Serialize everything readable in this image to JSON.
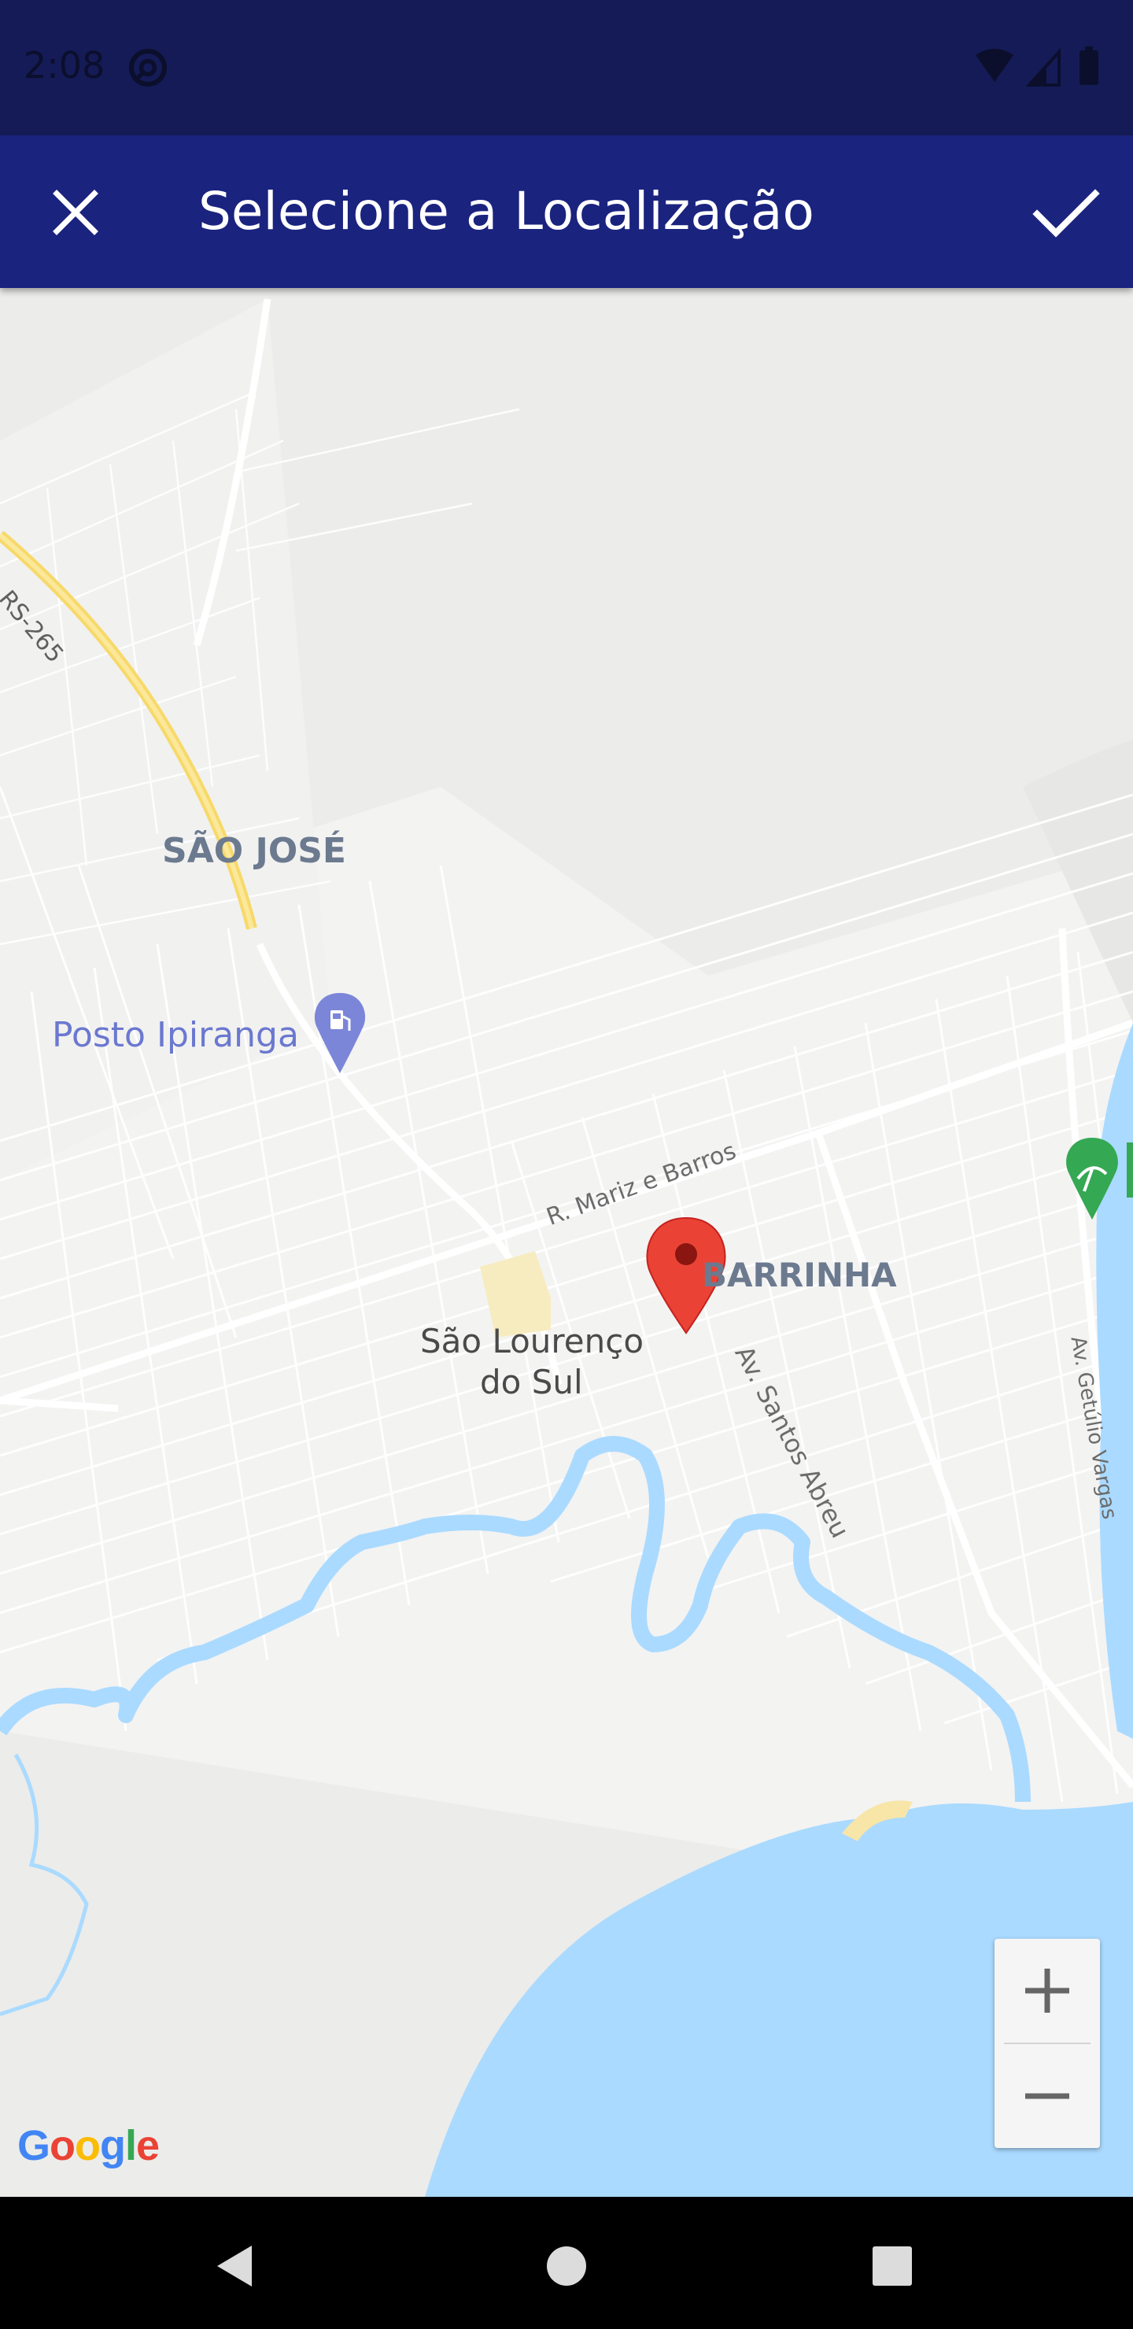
{
  "status_bar": {
    "time": "2:08",
    "icons": [
      "sync-icon",
      "wifi-icon",
      "cell-signal-icon",
      "battery-icon"
    ]
  },
  "app_bar": {
    "title": "Selecione a Localização",
    "close_icon": "close-icon",
    "confirm_icon": "check-icon",
    "background": "#1a237e"
  },
  "map": {
    "labels": {
      "road_rs265": "RS-265",
      "neighborhood_sao_jose": "SÃO JOSÉ",
      "poi_posto": "Posto Ipiranga",
      "street_mariz": "R. Mariz e Barros",
      "neighborhood_barrinha": "BARRINHA",
      "city_line1": "São Lourenço",
      "city_line2": "do Sul",
      "street_santos_abreu": "Av. Santos Abreu",
      "street_getulio": "Av. Getúlio Vargas"
    },
    "marker_color": "#ea4335",
    "water_color": "#aadaff",
    "zoom_in": "+",
    "zoom_out": "−",
    "attribution": [
      "G",
      "o",
      "o",
      "g",
      "l",
      "e"
    ]
  },
  "nav_bar": {
    "icons": [
      "back-icon",
      "home-icon",
      "recents-icon"
    ]
  }
}
